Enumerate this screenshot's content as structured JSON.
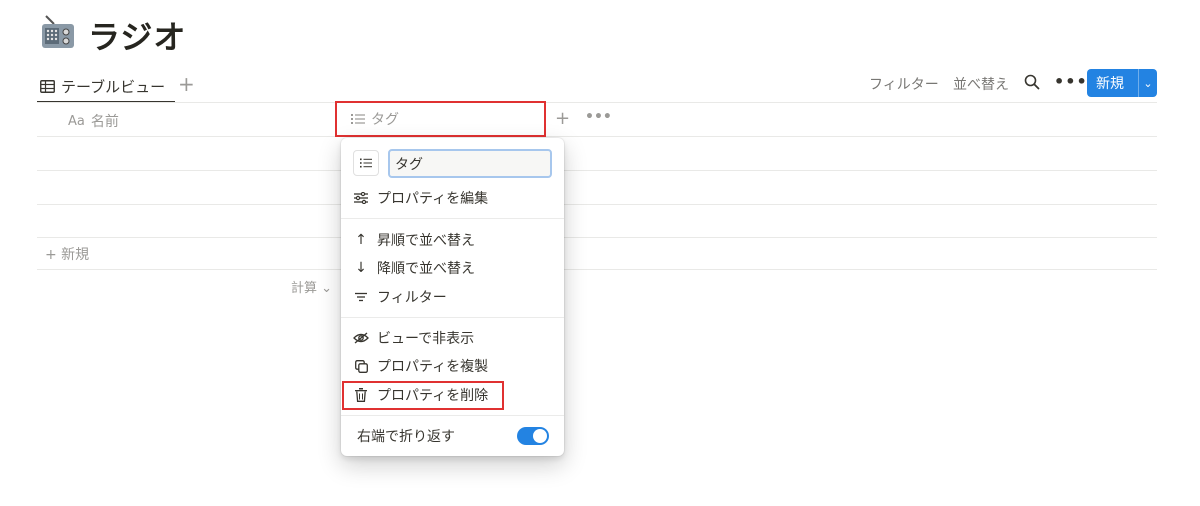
{
  "page": {
    "title": "ラジオ",
    "icon": "radio-icon"
  },
  "views": {
    "active_tab_label": "テーブルビュー",
    "add_view": "+"
  },
  "toolbar": {
    "filter": "フィルター",
    "sort": "並べ替え",
    "more": "•••",
    "new_label": "新規",
    "new_chevron": "⌄"
  },
  "table": {
    "columns": [
      {
        "label": "名前",
        "type_icon": "Aa"
      },
      {
        "label": "タグ",
        "type_icon": "list-icon"
      }
    ],
    "add_column": "+",
    "column_more": "•••",
    "new_row_label": "+ 新規",
    "calculate_label": "計算 ⌄"
  },
  "property_menu": {
    "name_value": "タグ",
    "items": [
      {
        "label": "プロパティを編集",
        "icon": "sliders-icon"
      },
      {
        "label": "昇順で並べ替え",
        "icon": "arrow-up-icon"
      },
      {
        "label": "降順で並べ替え",
        "icon": "arrow-down-icon"
      },
      {
        "label": "フィルター",
        "icon": "filter-icon"
      },
      {
        "label": "ビューで非表示",
        "icon": "eye-slash-icon"
      },
      {
        "label": "プロパティを複製",
        "icon": "duplicate-icon"
      },
      {
        "label": "プロパティを削除",
        "icon": "trash-icon"
      }
    ],
    "wrap_label": "右端で折り返す",
    "wrap_enabled": true
  },
  "colors": {
    "accent": "#2383e2",
    "highlight": "#e03131"
  }
}
